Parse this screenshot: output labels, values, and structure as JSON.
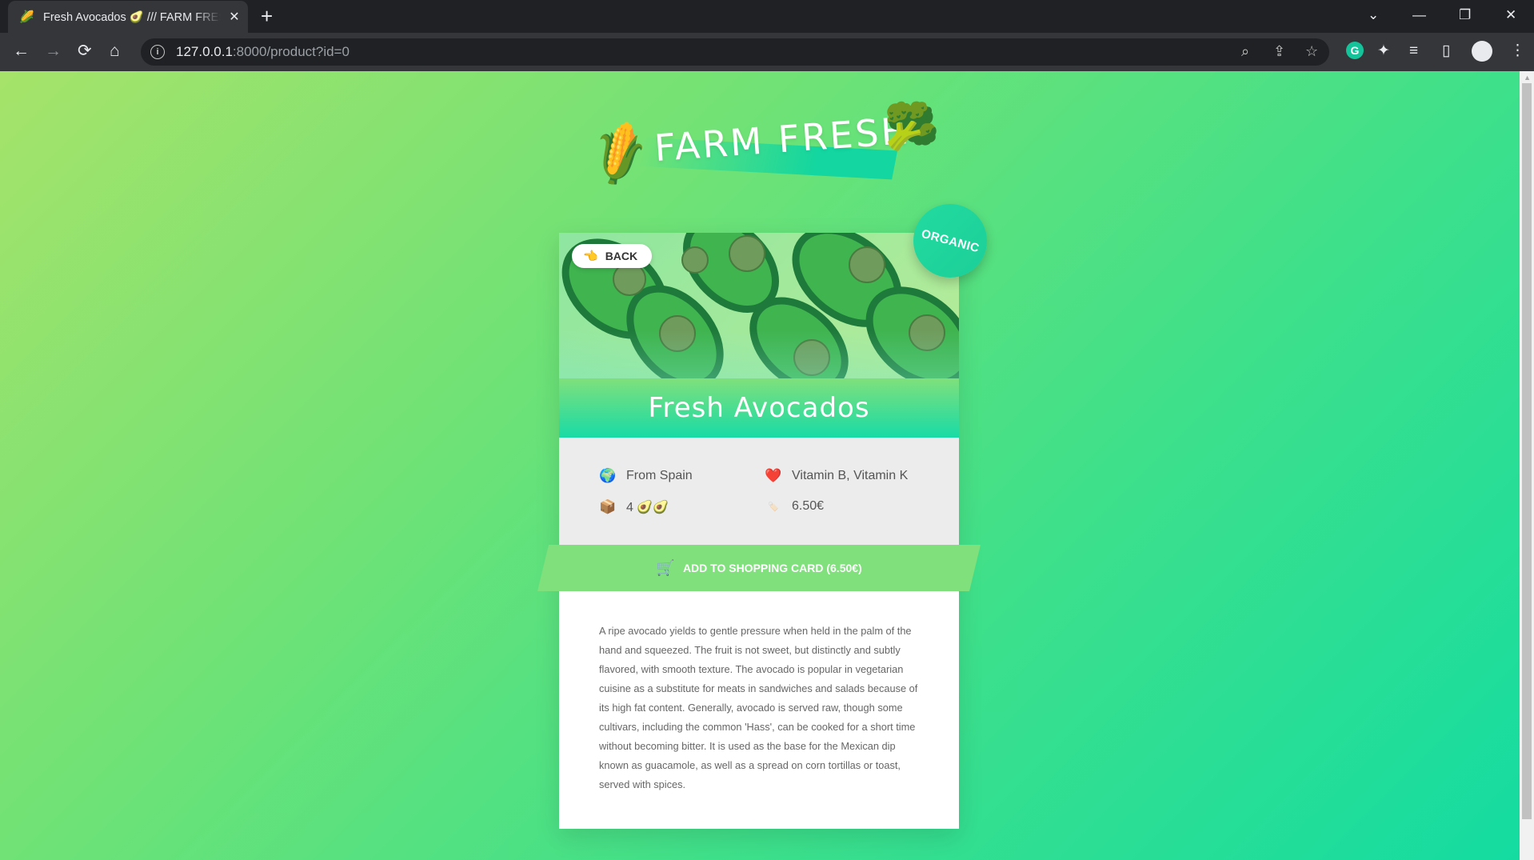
{
  "browser": {
    "tab_title": "Fresh Avocados 🥑 /// FARM FRESH",
    "tab_favicon": "🌽",
    "url_host": "127.0.0.1",
    "url_rest": ":8000/product?id=0"
  },
  "icons": {
    "back": "←",
    "forward": "→",
    "reload": "⟳",
    "home": "⌂",
    "zoom": "⌕",
    "share": "⇪",
    "star": "☆",
    "grammarly": "G",
    "extensions": "✦",
    "media": "≡",
    "sidepanel": "▯",
    "menu": "⋮",
    "new_tab": "+",
    "close_tab": "✕",
    "tab_list": "⌄",
    "minimize": "—",
    "restore": "❐",
    "close_window": "✕"
  },
  "page": {
    "logo_text": "FARM FRESH",
    "logo_left_emoji": "🌽",
    "logo_right_emoji": "🥦",
    "back_emoji": "👈",
    "back_label": "BACK",
    "badge": "ORGANIC",
    "product_name": "Fresh Avocados",
    "facts": {
      "origin_emoji": "🌍",
      "origin": "From Spain",
      "nutrients_emoji": "❤️",
      "nutrients": "Vitamin B, Vitamin K",
      "quantity_emoji": "📦",
      "quantity": "4 🥑🥑",
      "price_emoji": "🏷️",
      "price": "6.50€"
    },
    "cart_emoji": "🛒",
    "cart_label": "ADD TO SHOPPING CARD (6.50€)",
    "description": "A ripe avocado yields to gentle pressure when held in the palm of the hand and squeezed. The fruit is not sweet, but distinctly and subtly flavored, with smooth texture. The avocado is popular in vegetarian cuisine as a substitute for meats in sandwiches and salads because of its high fat content. Generally, avocado is served raw, though some cultivars, including the common 'Hass', can be cooked for a short time without becoming bitter. It is used as the base for the Mexican dip known as guacamole, as well as a spread on corn tortillas or toast, served with spices."
  }
}
